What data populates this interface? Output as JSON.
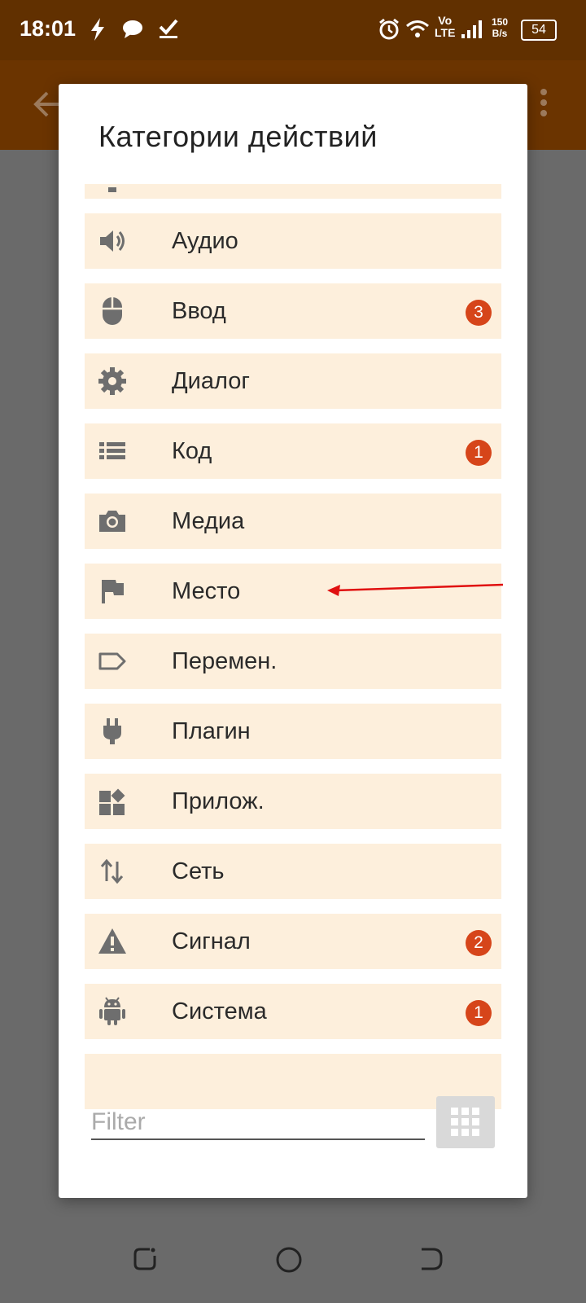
{
  "status_bar": {
    "time": "18:01",
    "net_speed_top": "150",
    "net_speed_bottom": "B/s",
    "volte_top": "Vo",
    "volte_bottom": "LTE",
    "battery": "54",
    "icons": [
      "flash-icon",
      "message-icon",
      "check-icon",
      "alarm-icon",
      "wifi-icon",
      "signal-icon",
      "battery-icon"
    ]
  },
  "dialog": {
    "title": "Категории действий",
    "categories": [
      {
        "label": "",
        "icon": "partial-icon",
        "badge": ""
      },
      {
        "label": "Аудио",
        "icon": "speaker-icon",
        "badge": ""
      },
      {
        "label": "Ввод",
        "icon": "mouse-icon",
        "badge": "3"
      },
      {
        "label": "Диалог",
        "icon": "gear-icon",
        "badge": ""
      },
      {
        "label": "Код",
        "icon": "list-icon",
        "badge": "1"
      },
      {
        "label": "Медиа",
        "icon": "camera-icon",
        "badge": ""
      },
      {
        "label": "Место",
        "icon": "flag-icon",
        "badge": ""
      },
      {
        "label": "Перемен.",
        "icon": "tag-icon",
        "badge": ""
      },
      {
        "label": "Плагин",
        "icon": "plug-icon",
        "badge": ""
      },
      {
        "label": "Прилож.",
        "icon": "apps-icon",
        "badge": ""
      },
      {
        "label": "Сеть",
        "icon": "updown-arrows-icon",
        "badge": ""
      },
      {
        "label": "Сигнал",
        "icon": "warning-icon",
        "badge": "2"
      },
      {
        "label": "Система",
        "icon": "android-icon",
        "badge": "1"
      }
    ],
    "filter": {
      "placeholder": "Filter",
      "value": ""
    }
  },
  "colors": {
    "status_bar": "#613000",
    "app_bar": "#6b3400",
    "item_bg": "#fdefdc",
    "badge": "#d6451a",
    "icon": "#6e6e6e",
    "annotation_arrow": "#e01010"
  }
}
